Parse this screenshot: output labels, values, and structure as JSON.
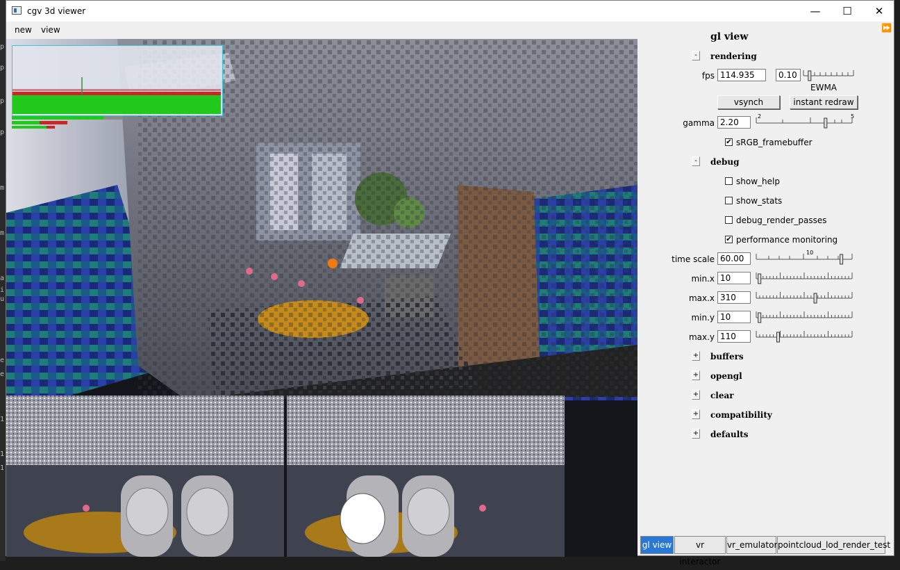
{
  "window": {
    "title": "cgv 3d viewer",
    "minimize_glyph": "—",
    "maximize_glyph": "☐",
    "close_glyph": "✕",
    "icon": "app-window-icon"
  },
  "menu": {
    "items": [
      "new",
      "view"
    ]
  },
  "panel": {
    "title": "gl view",
    "expand_glyph": "⏩",
    "rendering": {
      "toggle": "-",
      "label": "rendering",
      "fps_label": "fps",
      "fps_value": "114.935",
      "ewma_value": "0.10",
      "ewma_label": "EWMA",
      "ewma_level": 0.1,
      "vsynch_label": "vsynch",
      "instant_redraw_label": "instant redraw",
      "gamma_label": "gamma",
      "gamma_value": "2.20",
      "gamma_ticks": [
        "2",
        "5"
      ],
      "gamma_level": 0.73,
      "srgb_label": "sRGB_framebuffer",
      "srgb_checked": true
    },
    "debug": {
      "toggle": "-",
      "label": "debug",
      "show_help_label": "show_help",
      "show_stats_label": "show_stats",
      "debug_render_passes_label": "debug_render_passes",
      "perf_label": "performance monitoring",
      "perf_checked": true,
      "time_scale_label": "time scale",
      "time_scale_value": "60.00",
      "time_scale_tick": "10",
      "time_scale_level": 0.9,
      "min_x_label": "min.x",
      "min_x_value": "10",
      "min_x_level": 0.02,
      "max_x_label": "max.x",
      "max_x_value": "310",
      "max_x_level": 0.62,
      "min_y_label": "min.y",
      "min_y_value": "10",
      "min_y_level": 0.02,
      "max_y_label": "max.y",
      "max_y_value": "110",
      "max_y_level": 0.22
    },
    "sections": [
      {
        "toggle": "+",
        "label": "buffers"
      },
      {
        "toggle": "+",
        "label": "opengl"
      },
      {
        "toggle": "+",
        "label": "clear"
      },
      {
        "toggle": "+",
        "label": "compatibility"
      },
      {
        "toggle": "+",
        "label": "defaults"
      }
    ]
  },
  "tabs": [
    "gl view",
    "vr interactor",
    "vr_emulator",
    "pointcloud_lod_render_test"
  ],
  "colors": {
    "accent": "#2a78d6",
    "perf_green": "#22c91c",
    "perf_red": "#c8262a",
    "floor_orange": "#c48a1c"
  }
}
